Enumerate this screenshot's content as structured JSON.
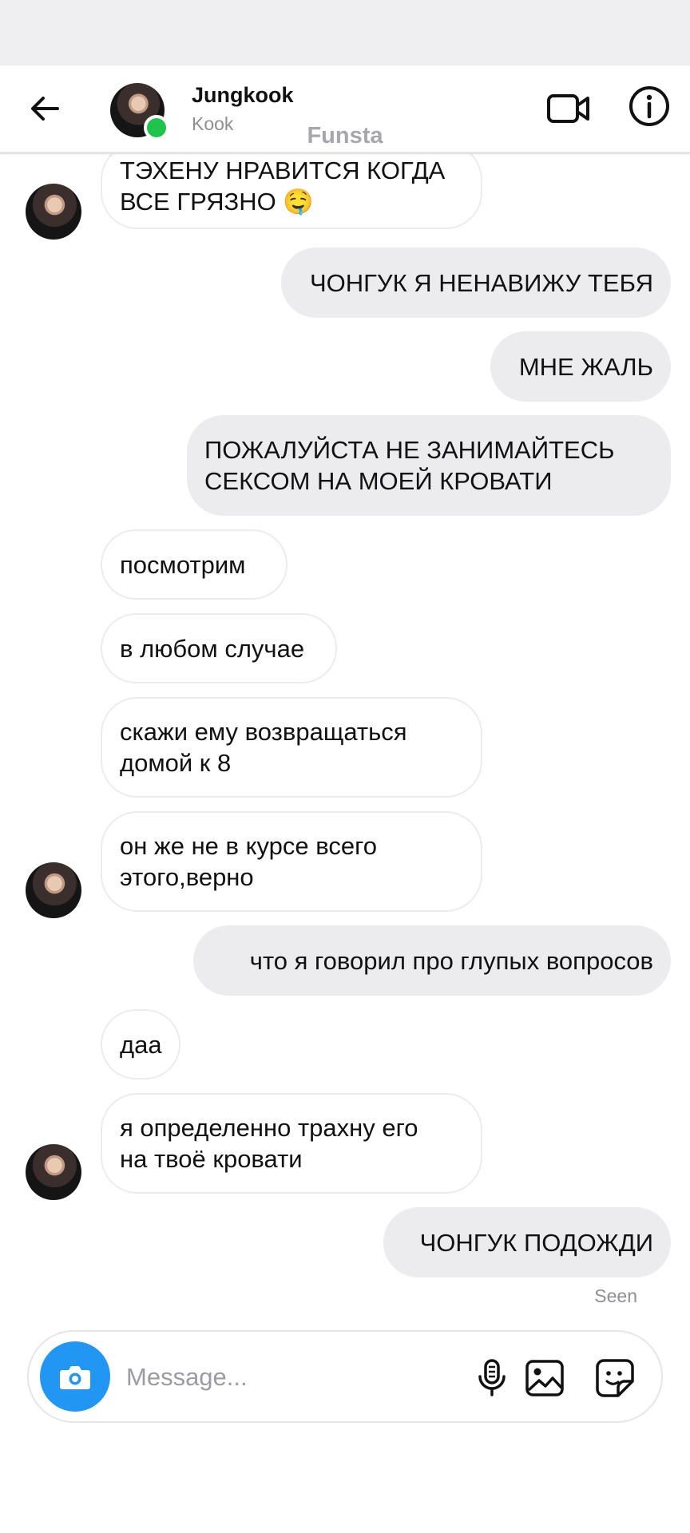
{
  "header": {
    "contact_name": "Jungkook",
    "contact_username": "Kook",
    "watermark": "Funsta",
    "online": true
  },
  "messages": [
    {
      "side": "in",
      "text": "ТЭХЕНУ НРАВИТСЯ КОГДА\nВСЕ ГРЯЗНО 🤤"
    },
    {
      "side": "out",
      "text": "ЧОНГУК Я НЕНАВИЖУ ТЕБЯ"
    },
    {
      "side": "out",
      "text": "МНЕ ЖАЛЬ"
    },
    {
      "side": "out",
      "text": "ПОЖАЛУЙСТА НЕ ЗАНИМАЙТЕСЬ\nСЕКСОМ НА МОЕЙ КРОВАТИ"
    },
    {
      "side": "in",
      "text": " посмотрим"
    },
    {
      "side": "in",
      "text": "в любом случае"
    },
    {
      "side": "in",
      "text": "скажи ему возвращаться\nдомой к 8"
    },
    {
      "side": "in",
      "text": "он же не в курсе всего\nэтого,верно"
    },
    {
      "side": "out",
      "text": "что я говорил про глупых вопросов"
    },
    {
      "side": "in",
      "text": "даа"
    },
    {
      "side": "in",
      "text": "я определенно трахну его\nна твоё кровати"
    },
    {
      "side": "out",
      "text": "ЧОНГУК ПОДОЖДИ"
    }
  ],
  "status": {
    "seen_label": "Seen"
  },
  "composer": {
    "placeholder": "Message..."
  },
  "icons": {
    "back": "arrow-left-icon",
    "video": "video-camera-icon",
    "info": "info-icon",
    "camera": "camera-icon",
    "mic": "microphone-icon",
    "gallery": "image-icon",
    "sticker": "sticker-icon"
  },
  "colors": {
    "accent": "#2196f3",
    "online": "#1fc44c",
    "outgoing_bubble": "#ececee",
    "incoming_border": "#ececee"
  }
}
